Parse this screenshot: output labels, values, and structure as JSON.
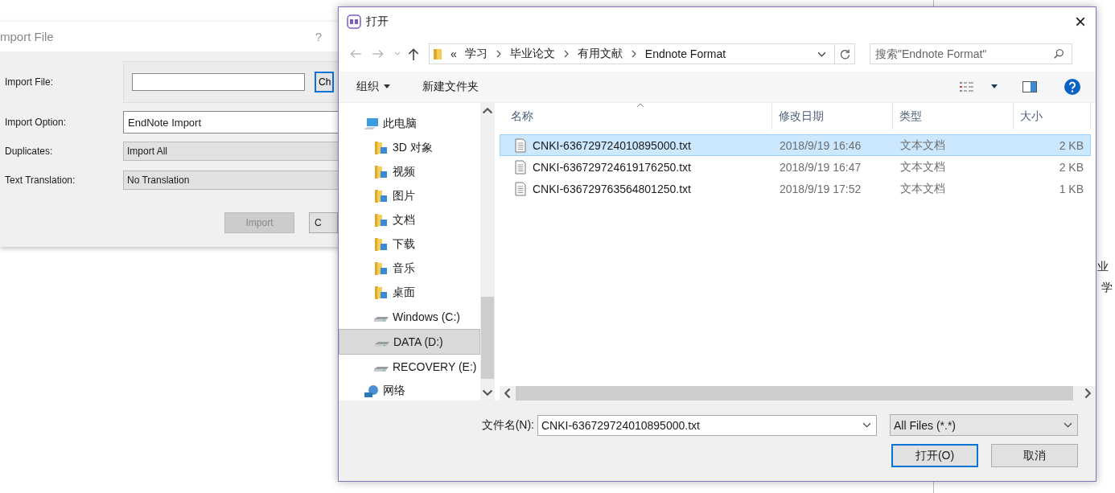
{
  "background_texts": [
    "业",
    "学"
  ],
  "import_dialog": {
    "title": "mport File",
    "help": "?",
    "fields": [
      {
        "label": "Import File:",
        "kind": "file",
        "button": "Ch"
      },
      {
        "label": "Import Option:",
        "kind": "combo",
        "value": "EndNote Import"
      },
      {
        "label": "Duplicates:",
        "kind": "select",
        "value": "Import All"
      },
      {
        "label": "Text Translation:",
        "kind": "select",
        "value": "No Translation"
      }
    ],
    "buttons": [
      {
        "label": "Import",
        "disabled": true
      },
      {
        "label": "C",
        "disabled": false
      }
    ]
  },
  "open_dialog": {
    "title": "打开",
    "close": "×",
    "breadcrumb": {
      "overflow": "«",
      "items": [
        "学习",
        "毕业论文",
        "有用文献",
        "Endnote Format"
      ]
    },
    "search": {
      "placeholder": "搜索\"Endnote Format\""
    },
    "toolbar": {
      "organize": "组织",
      "new_folder": "新建文件夹"
    },
    "nav": [
      {
        "label": "此电脑",
        "kind": "pc",
        "selected": false,
        "children": [
          {
            "label": "3D 对象",
            "kind": "folder",
            "selected": false
          },
          {
            "label": "视频",
            "kind": "folder",
            "selected": false
          },
          {
            "label": "图片",
            "kind": "folder",
            "selected": false
          },
          {
            "label": "文档",
            "kind": "folder",
            "selected": false
          },
          {
            "label": "下载",
            "kind": "folder",
            "selected": false
          },
          {
            "label": "音乐",
            "kind": "folder",
            "selected": false
          },
          {
            "label": "桌面",
            "kind": "folder",
            "selected": false
          },
          {
            "label": "Windows (C:)",
            "kind": "drive",
            "selected": false
          },
          {
            "label": "DATA (D:)",
            "kind": "drive",
            "selected": true
          },
          {
            "label": "RECOVERY (E:)",
            "kind": "drive",
            "selected": false
          }
        ]
      },
      {
        "label": "网络",
        "kind": "network",
        "selected": false
      }
    ],
    "columns": [
      "名称",
      "修改日期",
      "类型",
      "大小"
    ],
    "files": [
      {
        "name": "CNKI-636729724010895000.txt",
        "date": "2018/9/19 16:46",
        "type": "文本文档",
        "size": "2 KB",
        "selected": true
      },
      {
        "name": "CNKI-636729724619176250.txt",
        "date": "2018/9/19 16:47",
        "type": "文本文档",
        "size": "2 KB",
        "selected": false
      },
      {
        "name": "CNKI-636729763564801250.txt",
        "date": "2018/9/19 17:52",
        "type": "文本文档",
        "size": "1 KB",
        "selected": false
      }
    ],
    "filename_label": "文件名(N):",
    "filename": "CNKI-636729724010895000.txt",
    "filter": "All Files (*.*)",
    "buttons": [
      {
        "label": "打开(O)",
        "default": true
      },
      {
        "label": "取消",
        "default": false
      }
    ]
  }
}
